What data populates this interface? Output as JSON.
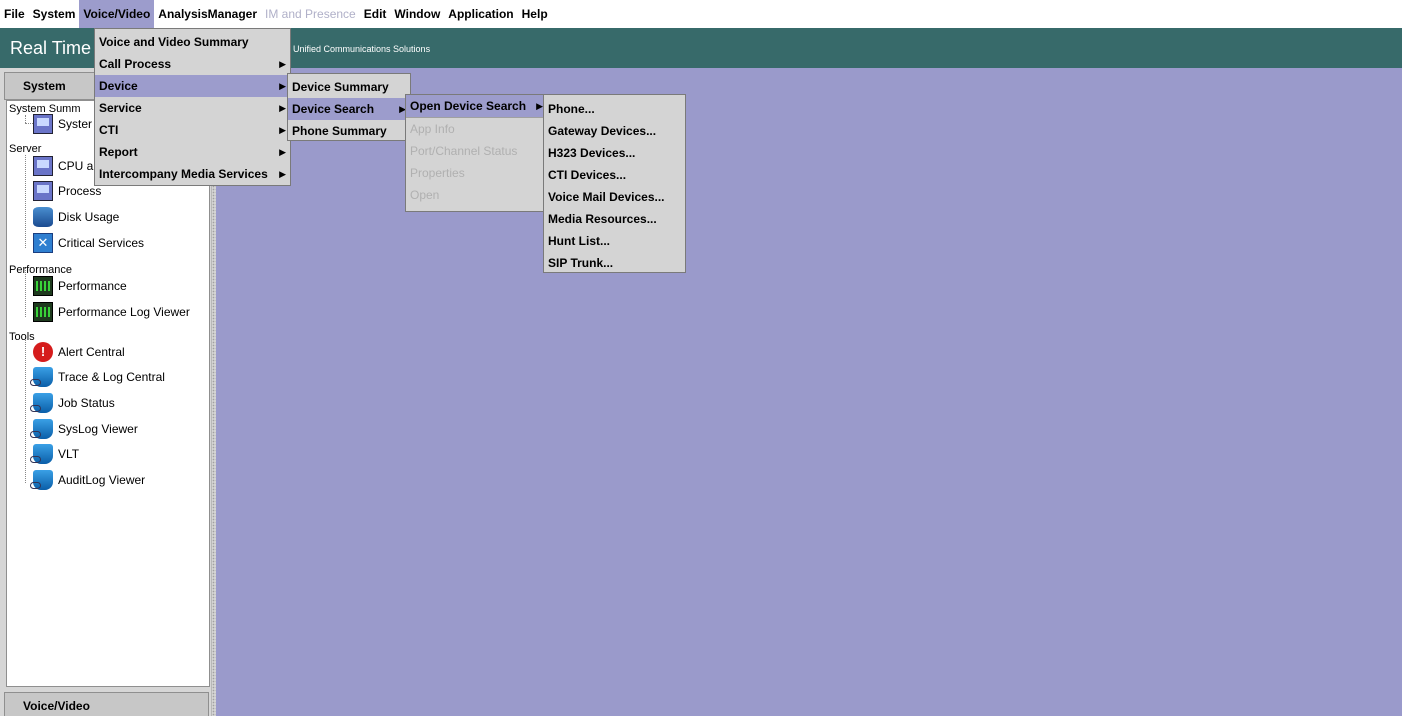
{
  "menubar": {
    "items": [
      "File",
      "System",
      "Voice/Video",
      "AnalysisManager",
      "IM and Presence",
      "Edit",
      "Window",
      "Application",
      "Help"
    ]
  },
  "banner": {
    "title": "Real Time",
    "subtitle": "Unified Communications Solutions"
  },
  "left_panel": {
    "system_tab": "System",
    "voice_tab": "Voice/Video",
    "tree": {
      "system_summary_label": "System Summ",
      "system_item": "Syster",
      "server_label": "Server",
      "cpu_item": "CPU a",
      "process_item": "Process",
      "disk_item": "Disk Usage",
      "critical_item": "Critical Services",
      "performance_label": "Performance",
      "performance_item": "Performance",
      "perf_log_item": "Performance Log Viewer",
      "tools_label": "Tools",
      "alert_item": "Alert Central",
      "trace_item": "Trace & Log Central",
      "job_item": "Job Status",
      "syslog_item": "SysLog Viewer",
      "vlt_item": "VLT",
      "audit_item": "AuditLog Viewer"
    }
  },
  "menus": {
    "voice_video": [
      "Voice and Video Summary",
      "Call Process",
      "Device",
      "Service",
      "CTI",
      "Report",
      "Intercompany Media Services"
    ],
    "device": [
      "Device Summary",
      "Device Search",
      "Phone Summary"
    ],
    "device_search": [
      "Open Device Search",
      "App Info",
      "Port/Channel Status",
      "Properties",
      "Open"
    ],
    "open_device_search": [
      "Phone...",
      "Gateway Devices...",
      "H323 Devices...",
      "CTI Devices...",
      "Voice Mail Devices...",
      "Media Resources...",
      "Hunt List...",
      "SIP Trunk..."
    ]
  },
  "colors": {
    "banner": "#376a6a",
    "workspace": "#9a9acb",
    "menu_highlight": "#9c9ccc"
  }
}
